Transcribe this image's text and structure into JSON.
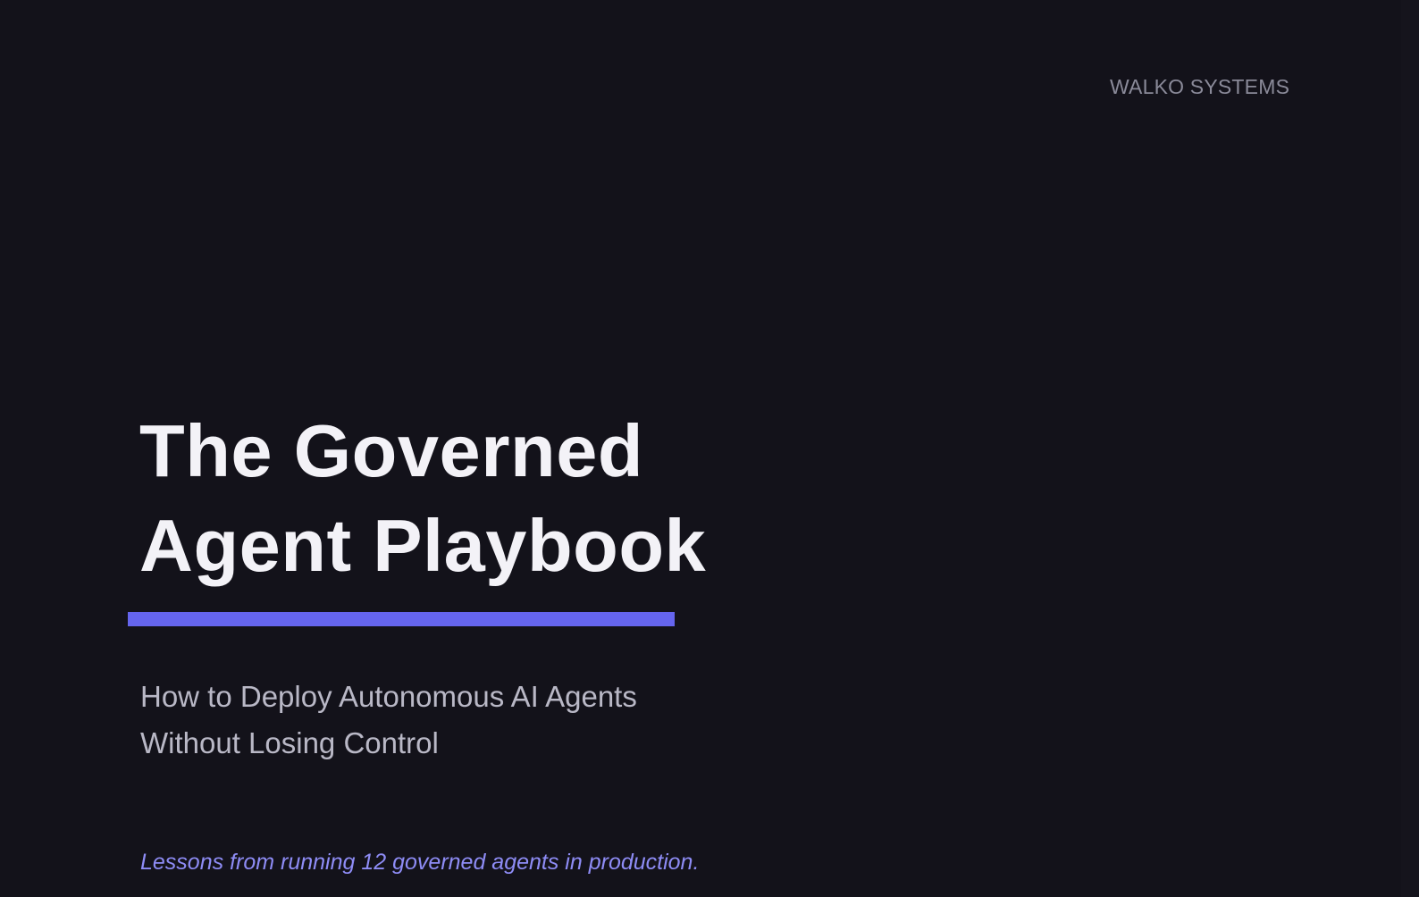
{
  "brand": {
    "name": "WALKO SYSTEMS"
  },
  "cover": {
    "title_line1": "The Governed",
    "title_line2": "Agent Playbook",
    "subtitle_line1": "How to Deploy Autonomous AI Agents",
    "subtitle_line2": "Without Losing Control",
    "tagline": "Lessons from running 12 governed agents in production."
  },
  "colors": {
    "background": "#13121a",
    "accent": "#6565ee",
    "title_text": "#f3f2f7",
    "subtitle_text": "#b9b8c6",
    "tagline_text": "#8e8cf5",
    "brand_text": "#8a8a99"
  }
}
